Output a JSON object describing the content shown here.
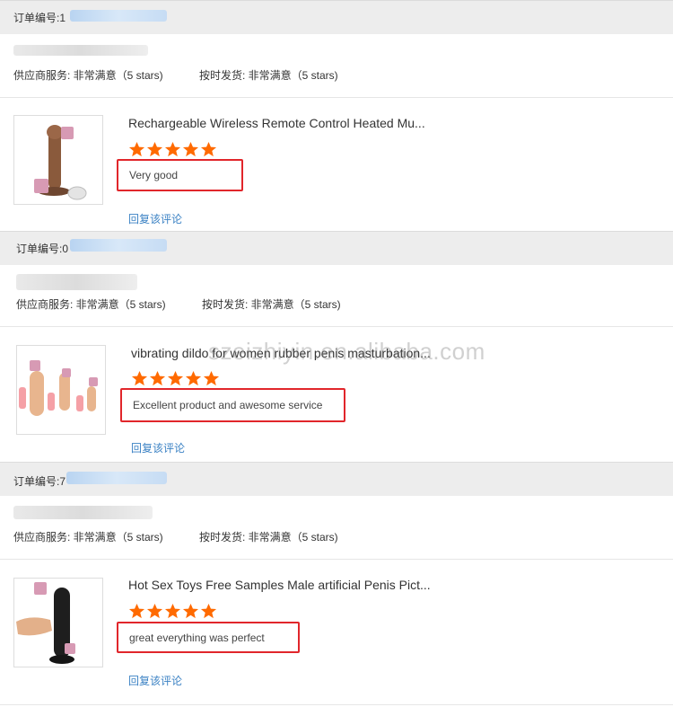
{
  "orders": [
    {
      "order_label": "订单编号:1",
      "buyer_name": "",
      "supplier_service": "供应商服务: 非常满意（5 stars)",
      "on_time_delivery": "按时发货: 非常满意（5 stars)",
      "product_title": "Rechargeable Wireless Remote Control Heated Mu...",
      "rating": 5,
      "review_text": "Very good",
      "reply_label": "回复该评论",
      "thumb_icon": "product-image"
    },
    {
      "order_label": "订单编号:0",
      "buyer_name": "",
      "supplier_service": "供应商服务: 非常满意（5 stars)",
      "on_time_delivery": "按时发货: 非常满意（5 stars)",
      "product_title": "vibrating dildo for women rubber penis masturbation...",
      "rating": 5,
      "review_text": "Excellent product and awesome service",
      "reply_label": "回复该评论",
      "thumb_icon": "product-image"
    },
    {
      "order_label": "订单编号:7",
      "buyer_name": "",
      "supplier_service": "供应商服务: 非常满意（5 stars)",
      "on_time_delivery": "按时发货: 非常满意（5 stars)",
      "product_title": "Hot Sex Toys Free Samples Male artificial Penis Pict...",
      "rating": 5,
      "review_text": "great everything was perfect",
      "reply_label": "回复该评论",
      "thumb_icon": "product-image"
    }
  ],
  "watermark": "szeizhiyin.en.alibaba.com",
  "colors": {
    "star": "#ff6a00",
    "highlight_box": "#e1262b",
    "link": "#3b82c4",
    "order_bar": "#ededed"
  }
}
